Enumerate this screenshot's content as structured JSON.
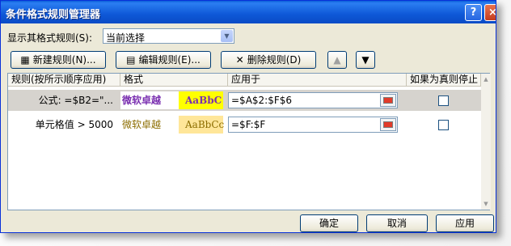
{
  "window": {
    "title": "条件格式规则管理器",
    "help": "?",
    "close": "×"
  },
  "show_rules": {
    "label": "显示其格式规则(S):",
    "value": "当前选择",
    "arrow": "▼"
  },
  "toolbar": {
    "new_label": "新建规则(N)...",
    "edit_label": "编辑规则(E)...",
    "delete_label": "删除规则(D)",
    "up_arrow": "▲",
    "down_arrow": "▼",
    "new_icon": "new-rule-icon",
    "edit_icon": "edit-rule-icon",
    "delete_icon": "delete-x-icon"
  },
  "table": {
    "headers": [
      "规则(按所示顺序应用)",
      "格式",
      "应用于",
      "如果为真则停止"
    ],
    "rows": [
      {
        "rule": "公式: =$B2=\"...",
        "format_cn": "微软卓越",
        "format_en": "AaBbC",
        "range": "=$A$2:$F$6",
        "stop": false
      },
      {
        "rule": "单元格值 > 5000",
        "format_cn": "微软卓越",
        "format_en": "AaBbCc",
        "range": "=$F:$F",
        "stop": false
      }
    ]
  },
  "footer": {
    "ok_label": "确定",
    "cancel_label": "取消",
    "apply_label": "应用"
  },
  "colors": {
    "title_bar": "#0a5fd8",
    "row_selected": "#d6d3ce",
    "format1_bg": "#ffff00",
    "format1_text": "#7a2fb0",
    "format2_bg": "#ffe699"
  }
}
